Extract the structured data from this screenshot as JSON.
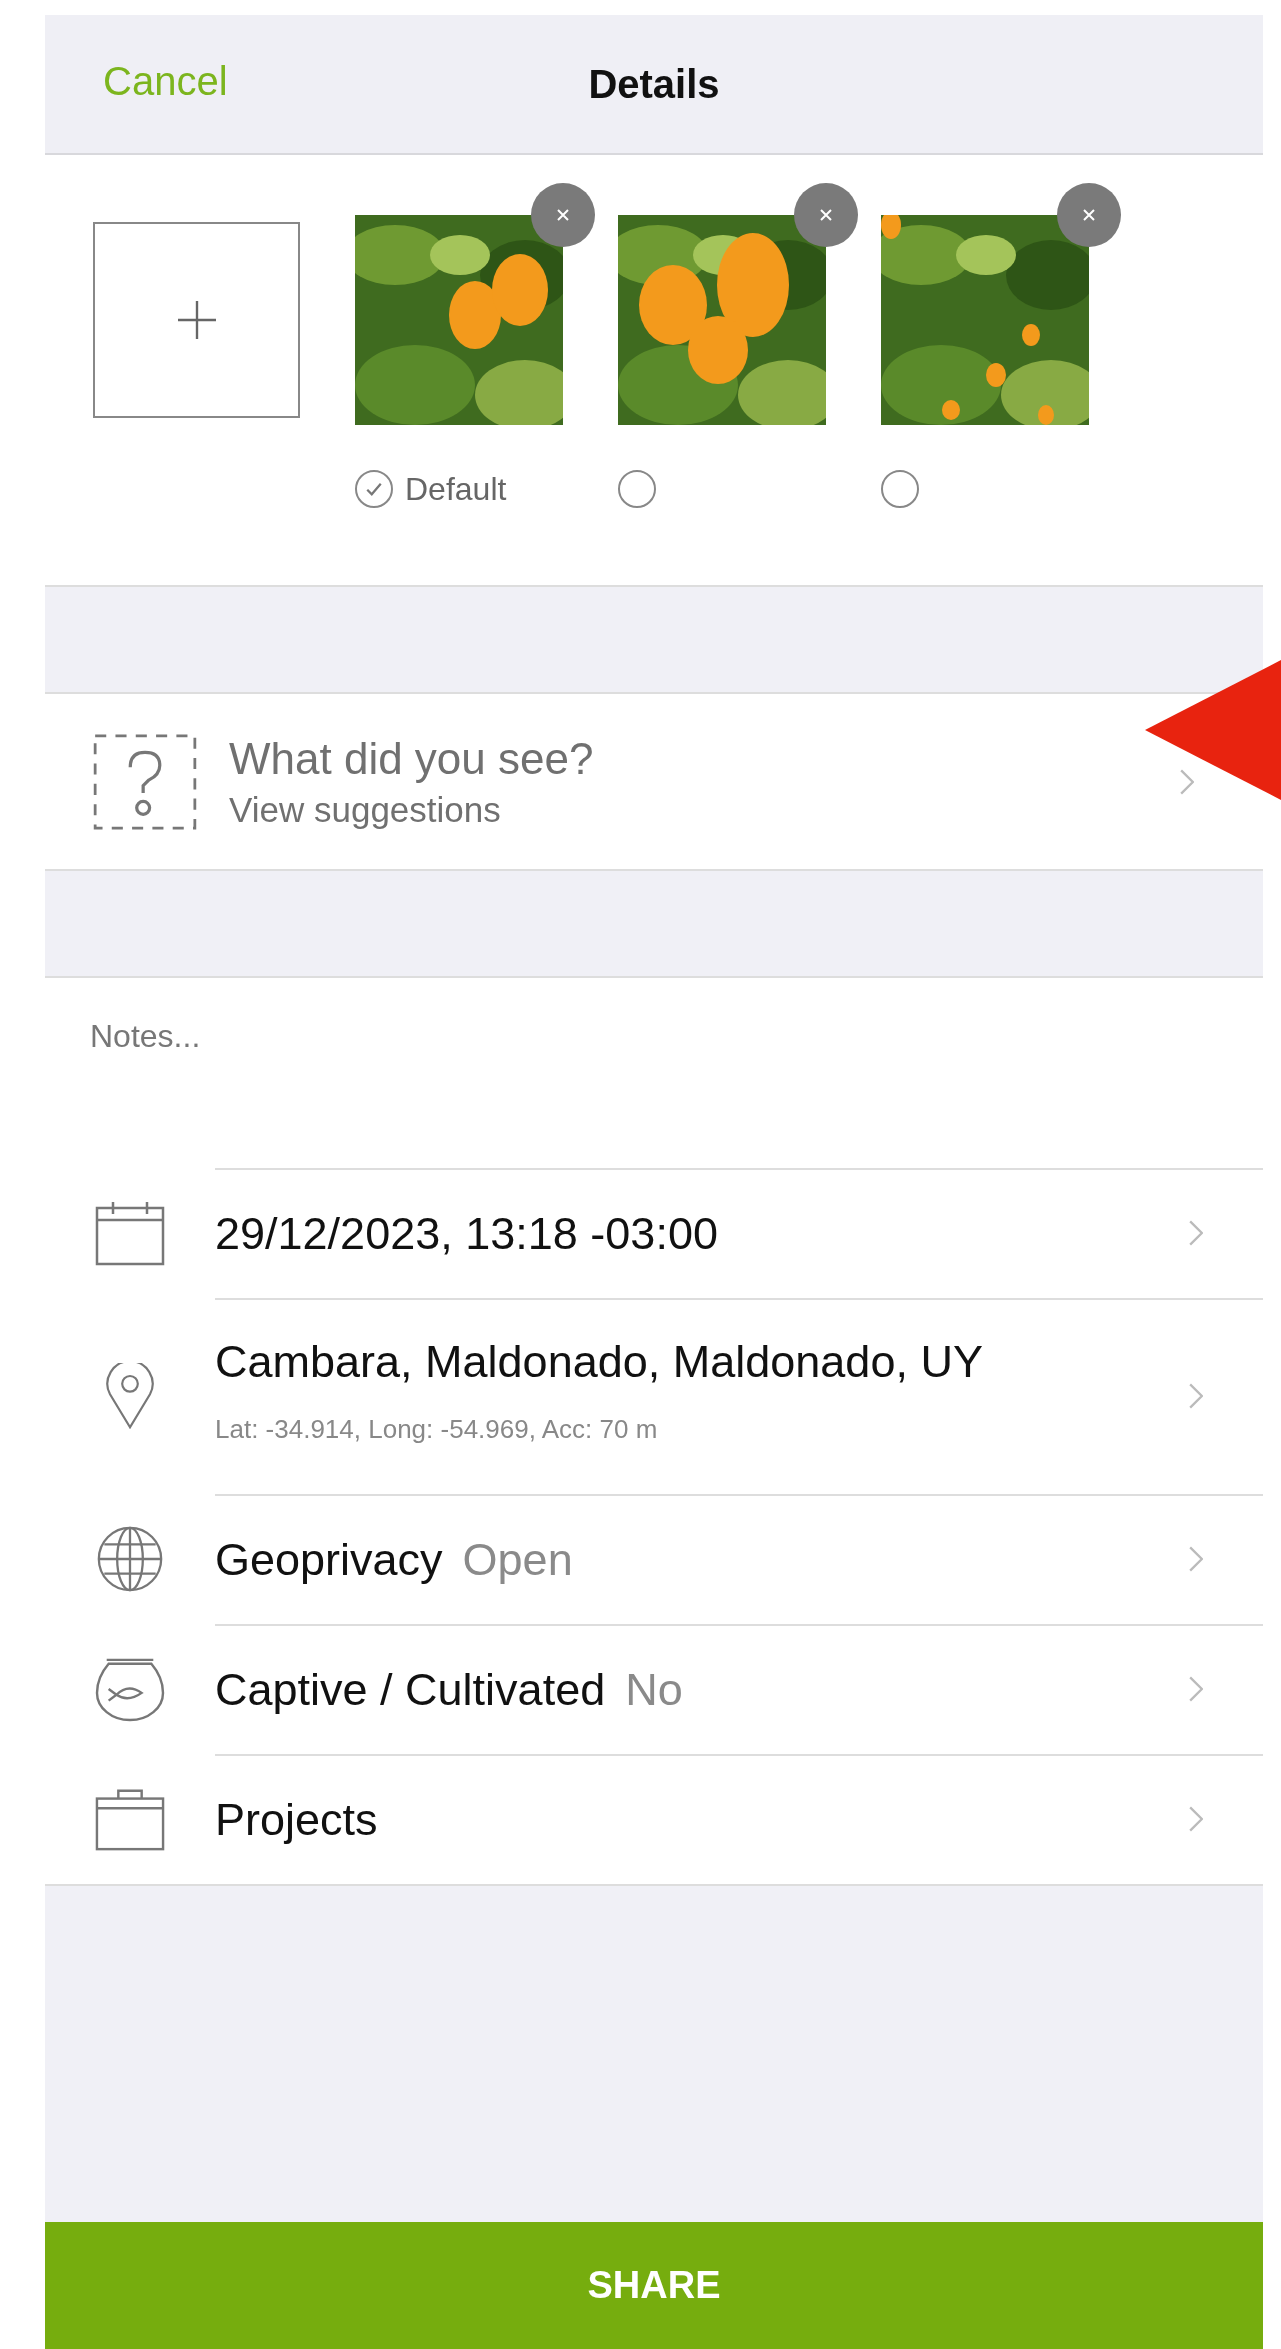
{
  "nav": {
    "cancel": "Cancel",
    "title": "Details"
  },
  "photos": [
    {
      "selected": true,
      "label": "Default"
    },
    {
      "selected": false
    },
    {
      "selected": false
    }
  ],
  "species": {
    "title": "What did you see?",
    "link": "View suggestions"
  },
  "notes": {
    "placeholder": "Notes..."
  },
  "rows": [
    {
      "kind": "date",
      "title": "29/12/2023, 13:18 -03:00"
    },
    {
      "kind": "location",
      "title": "Cambara, Maldonado, Maldonado, UY",
      "subtitle": "Lat: -34.914, Long: -54.969, Acc: 70 m"
    },
    {
      "kind": "geoprivacy",
      "title": "Geoprivacy",
      "value": "Open"
    },
    {
      "kind": "captive",
      "title": "Captive / Cultivated",
      "value": "No"
    },
    {
      "kind": "projects",
      "title": "Projects"
    }
  ],
  "share_button": "SHARE"
}
